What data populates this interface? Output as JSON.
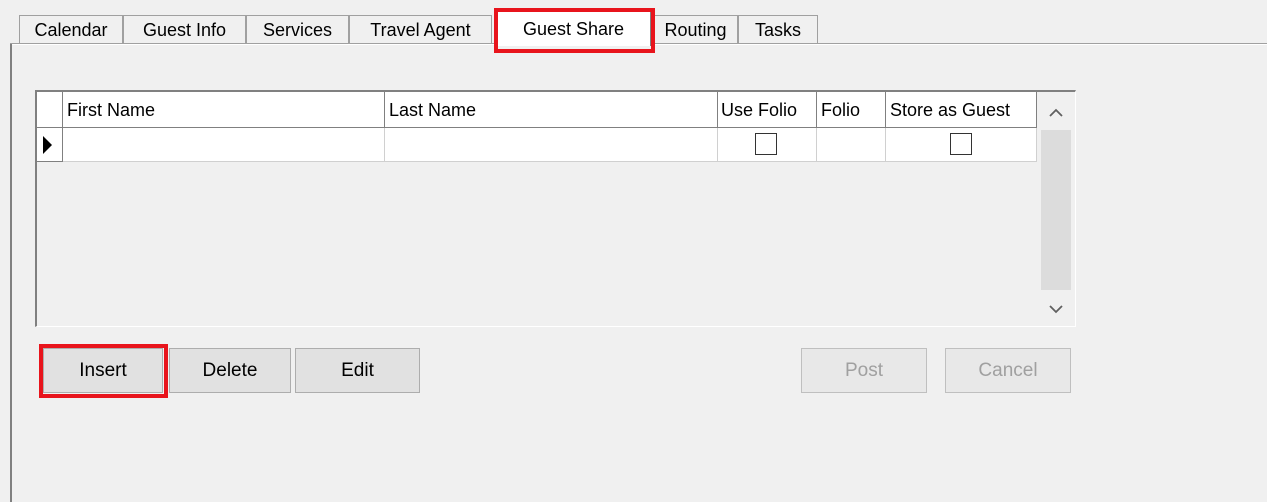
{
  "tabs": [
    {
      "label": "Calendar"
    },
    {
      "label": "Guest Info"
    },
    {
      "label": "Services"
    },
    {
      "label": "Travel Agent"
    },
    {
      "label": "Guest Share"
    },
    {
      "label": "Routing"
    },
    {
      "label": "Tasks"
    }
  ],
  "active_tab": "Guest Share",
  "grid": {
    "columns": [
      "First Name",
      "Last Name",
      "Use Folio",
      "Folio",
      "Store as Guest"
    ],
    "rows": [
      {
        "first_name": "",
        "last_name": "",
        "use_folio": false,
        "folio": "",
        "store_as_guest": false
      }
    ]
  },
  "buttons": {
    "insert": "Insert",
    "delete": "Delete",
    "edit": "Edit",
    "post": "Post",
    "cancel": "Cancel"
  },
  "colors": {
    "highlight": "#e8141c",
    "disabled_text": "#a0a0a0"
  },
  "icons": {
    "row_indicator": "current-row-arrow-icon",
    "scroll_up": "chevron-up-icon",
    "scroll_down": "chevron-down-icon"
  }
}
